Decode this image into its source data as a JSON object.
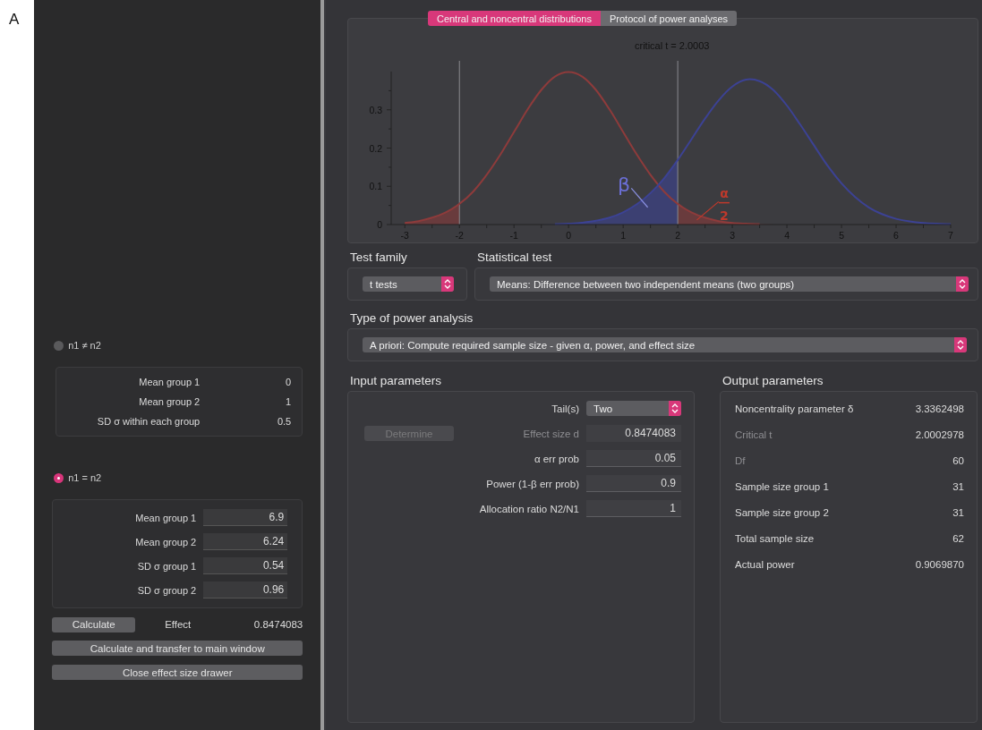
{
  "figure_label": "A",
  "drawer": {
    "groups": [
      {
        "label": "n1 ≠ n2",
        "selected": false,
        "fields": [
          {
            "label": "Mean group 1",
            "value": "0"
          },
          {
            "label": "Mean group 2",
            "value": "1"
          },
          {
            "label": "SD σ within each group",
            "value": "0.5"
          }
        ]
      },
      {
        "label": "n1 = n2",
        "selected": true,
        "fields": [
          {
            "label": "Mean group 1",
            "value": "6.9"
          },
          {
            "label": "Mean group 2",
            "value": "6.24"
          },
          {
            "label": "SD σ group 1",
            "value": "0.54"
          },
          {
            "label": "SD σ group 2",
            "value": "0.96"
          }
        ]
      }
    ],
    "calculate_button": "Calculate",
    "effect_label": "Effect",
    "effect_value": "0.8474083",
    "buttons": [
      "Calculate and transfer to main window",
      "Close effect size drawer"
    ]
  },
  "tabs": [
    {
      "label": "Central and noncentral distributions",
      "selected": true
    },
    {
      "label": "Protocol of power analyses",
      "selected": false
    }
  ],
  "chart_data": {
    "type": "line",
    "title": "critical t = 2.0003",
    "x": [
      -3,
      -2.75,
      -2.5,
      -2.25,
      -2,
      -1.75,
      -1.5,
      -1.25,
      -1,
      -0.75,
      -0.5,
      -0.25,
      0,
      0.25,
      0.5,
      0.75,
      1,
      1.25,
      1.5,
      1.75,
      2,
      2.25,
      2.5,
      2.75,
      3,
      3.25,
      3.5,
      3.75,
      4,
      4.25,
      4.5,
      4.75,
      5,
      5.25,
      5.5,
      5.75,
      6,
      6.25,
      6.5,
      6.75,
      7
    ],
    "series": [
      {
        "color": "#8e3b3b",
        "values": [
          0.004,
          0.009,
          0.018,
          0.032,
          0.054,
          0.086,
          0.13,
          0.183,
          0.242,
          0.301,
          0.352,
          0.387,
          0.399,
          0.387,
          0.352,
          0.301,
          0.242,
          0.183,
          0.13,
          0.086,
          0.054,
          0.032,
          0.018,
          0.009,
          0.004,
          0.002,
          0.001,
          null,
          null,
          null,
          null,
          null,
          null,
          null,
          null,
          null,
          null,
          null,
          null,
          null,
          null
        ]
      },
      {
        "color": "#3c4294",
        "values": [
          null,
          null,
          null,
          null,
          null,
          null,
          null,
          null,
          null,
          null,
          null,
          0.001,
          0.002,
          0.005,
          0.01,
          0.018,
          0.032,
          0.053,
          0.082,
          0.121,
          0.169,
          0.223,
          0.277,
          0.325,
          0.361,
          0.379,
          0.375,
          0.352,
          0.311,
          0.26,
          0.206,
          0.153,
          0.108,
          0.072,
          0.045,
          0.027,
          0.015,
          0.008,
          0.004,
          0.002,
          0.001
        ]
      }
    ],
    "xlim": [
      -3.25,
      7
    ],
    "ylim": [
      0,
      0.4
    ],
    "xticks": [
      -3,
      -2,
      -1,
      0,
      1,
      2,
      3,
      4,
      5,
      6,
      7
    ],
    "yticks": [
      0,
      0.1,
      0.2,
      0.3
    ],
    "annotations": [
      "β",
      "α",
      "2"
    ]
  },
  "test_family": {
    "label": "Test family",
    "value": "t tests"
  },
  "statistical_test": {
    "label": "Statistical test",
    "value": "Means: Difference between two independent means (two groups)"
  },
  "power_analysis": {
    "label": "Type of power analysis",
    "value": "A priori: Compute required sample size - given α, power, and effect size"
  },
  "input_parameters": {
    "title": "Input parameters",
    "determine_button": {
      "label": "Determine",
      "disabled": true
    },
    "rows": [
      {
        "kind": "select",
        "label": "Tail(s)",
        "value": "Two"
      },
      {
        "kind": "computed",
        "label": "Effect size d",
        "value": "0.8474083"
      },
      {
        "kind": "input",
        "label": "α err prob",
        "value": "0.05"
      },
      {
        "kind": "input",
        "label": "Power (1-β err prob)",
        "value": "0.9"
      },
      {
        "kind": "input",
        "label": "Allocation ratio N2/N1",
        "value": "1"
      }
    ]
  },
  "output_parameters": {
    "title": "Output parameters",
    "rows": [
      {
        "label": "Noncentrality parameter δ",
        "value": "3.3362498",
        "dimmed": false
      },
      {
        "label": "Critical t",
        "value": "2.0002978",
        "dimmed": true
      },
      {
        "label": "Df",
        "value": "60",
        "dimmed": true
      },
      {
        "label": "Sample size group 1",
        "value": "31",
        "dimmed": false
      },
      {
        "label": "Sample size group 2",
        "value": "31",
        "dimmed": false
      },
      {
        "label": "Total sample size",
        "value": "62",
        "dimmed": false
      },
      {
        "label": "Actual power",
        "value": "0.9069870",
        "dimmed": false
      }
    ]
  }
}
